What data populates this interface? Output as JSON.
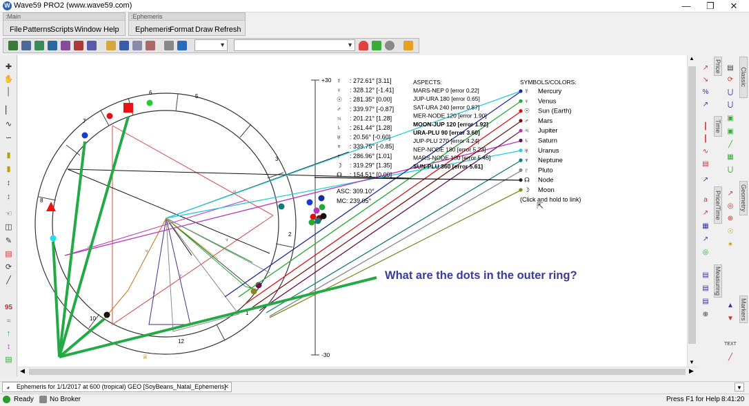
{
  "window": {
    "title": "Wave59 PRO2 (www.wave59.com)",
    "app_icon": "W"
  },
  "main_panel": {
    "caption": ":Main",
    "menu": [
      "File",
      "Patterns",
      "Scripts",
      "Window",
      "Help"
    ]
  },
  "ephemeris_panel": {
    "caption": ":Ephemeris",
    "menu": [
      "Ephemeris",
      "Format",
      "Draw",
      "Refresh"
    ]
  },
  "toolbar": {
    "combo1_value": "",
    "combo2_value": ""
  },
  "planet_positions": [
    {
      "glyph": "☿",
      "value": ": 272.61° [3.11]"
    },
    {
      "glyph": "♀",
      "value": ": 328.12° [-1.41]"
    },
    {
      "glyph": "☉",
      "value": ": 281.35° [0.00]"
    },
    {
      "glyph": "♂",
      "value": ": 339.97° [-0.87]"
    },
    {
      "glyph": "♃",
      "value": ": 201.21° [1.28]"
    },
    {
      "glyph": "♄",
      "value": ": 261.44° [1.28]"
    },
    {
      "glyph": "♅",
      "value": ": 20.56° [-0.60]"
    },
    {
      "glyph": "♆",
      "value": ": 339.75° [-0.85]"
    },
    {
      "glyph": "♇",
      "value": ": 286.96° [1.01]"
    },
    {
      "glyph": "☽",
      "value": ": 319.29° [1.35]"
    },
    {
      "glyph": "☊",
      "value": ": 154.51° [0.00]"
    }
  ],
  "asc": "ASC: 309.10°",
  "mc": "MC: 239.05°",
  "aspects": {
    "header": "ASPECTS:",
    "items": [
      {
        "text": "MARS-NEP 0 [error 0.22]",
        "bold": false
      },
      {
        "text": "JUP-URA 180 [error 0.65]",
        "bold": false
      },
      {
        "text": "SAT-URA 240 [error 0.87]",
        "bold": false
      },
      {
        "text": "MER-NODE 120 [error 1.90]",
        "bold": false
      },
      {
        "text": "MOON-JUP 120 [error 1.92]",
        "bold": true
      },
      {
        "text": "URA-PLU 90 [error 3.60]",
        "bold": true
      },
      {
        "text": "JUP-PLU 270 [error 4.24]",
        "bold": false
      },
      {
        "text": "NEP-NODE 180 [error 5.23]",
        "bold": false
      },
      {
        "text": "MARS-NODE 180 [error 5.45]",
        "bold": false
      },
      {
        "text": "SUN-PLU 360 [error 5.61]",
        "bold": true
      }
    ]
  },
  "symbols": {
    "header": "SYMBOLS/COLORS:",
    "items": [
      {
        "glyph": "☿",
        "name": "Mercury",
        "color": "#1a2aa0"
      },
      {
        "glyph": "♀",
        "name": "Venus",
        "color": "#22aa33"
      },
      {
        "glyph": "☉",
        "name": "Sun (Earth)",
        "color": "#dd1111"
      },
      {
        "glyph": "♂",
        "name": "Mars",
        "color": "#7a1010"
      },
      {
        "glyph": "♃",
        "name": "Jupiter",
        "color": "#bb33bb"
      },
      {
        "glyph": "♄",
        "name": "Saturn",
        "color": "#6a1050"
      },
      {
        "glyph": "♅",
        "name": "Uranus",
        "color": "#22ccdd"
      },
      {
        "glyph": "♆",
        "name": "Neptune",
        "color": "#117a7a"
      },
      {
        "glyph": "♇",
        "name": "Pluto",
        "color": "#888888"
      },
      {
        "glyph": "☊",
        "name": "Node",
        "color": "#222222"
      },
      {
        "glyph": "☽",
        "name": "Moon",
        "color": "#888822"
      }
    ],
    "hint": "(Click and hold to link)"
  },
  "scale": {
    "top": "+30",
    "bottom": "-30"
  },
  "wheel_house_numbers": [
    "6",
    "5",
    "7",
    "3",
    "8",
    "2",
    "10",
    "1",
    "12"
  ],
  "annotation": "What are the dots in the outer ring?",
  "right_tabs": [
    "Classic",
    "Price",
    "Time",
    "Geometry",
    "Price/Time",
    "Measuring",
    "Markers"
  ],
  "right_icon_text": "TEXT",
  "left_toolbar_labels": {
    "n95": "95"
  },
  "doc_tab": "Ephemeris for 1/1/2017 at 600 (tropical) GEO [SoyBeans_Natal_Ephemeris]",
  "status": {
    "ready": "Ready",
    "broker": "No Broker",
    "help": "Press F1 for Help",
    "time": "8:41:20"
  }
}
